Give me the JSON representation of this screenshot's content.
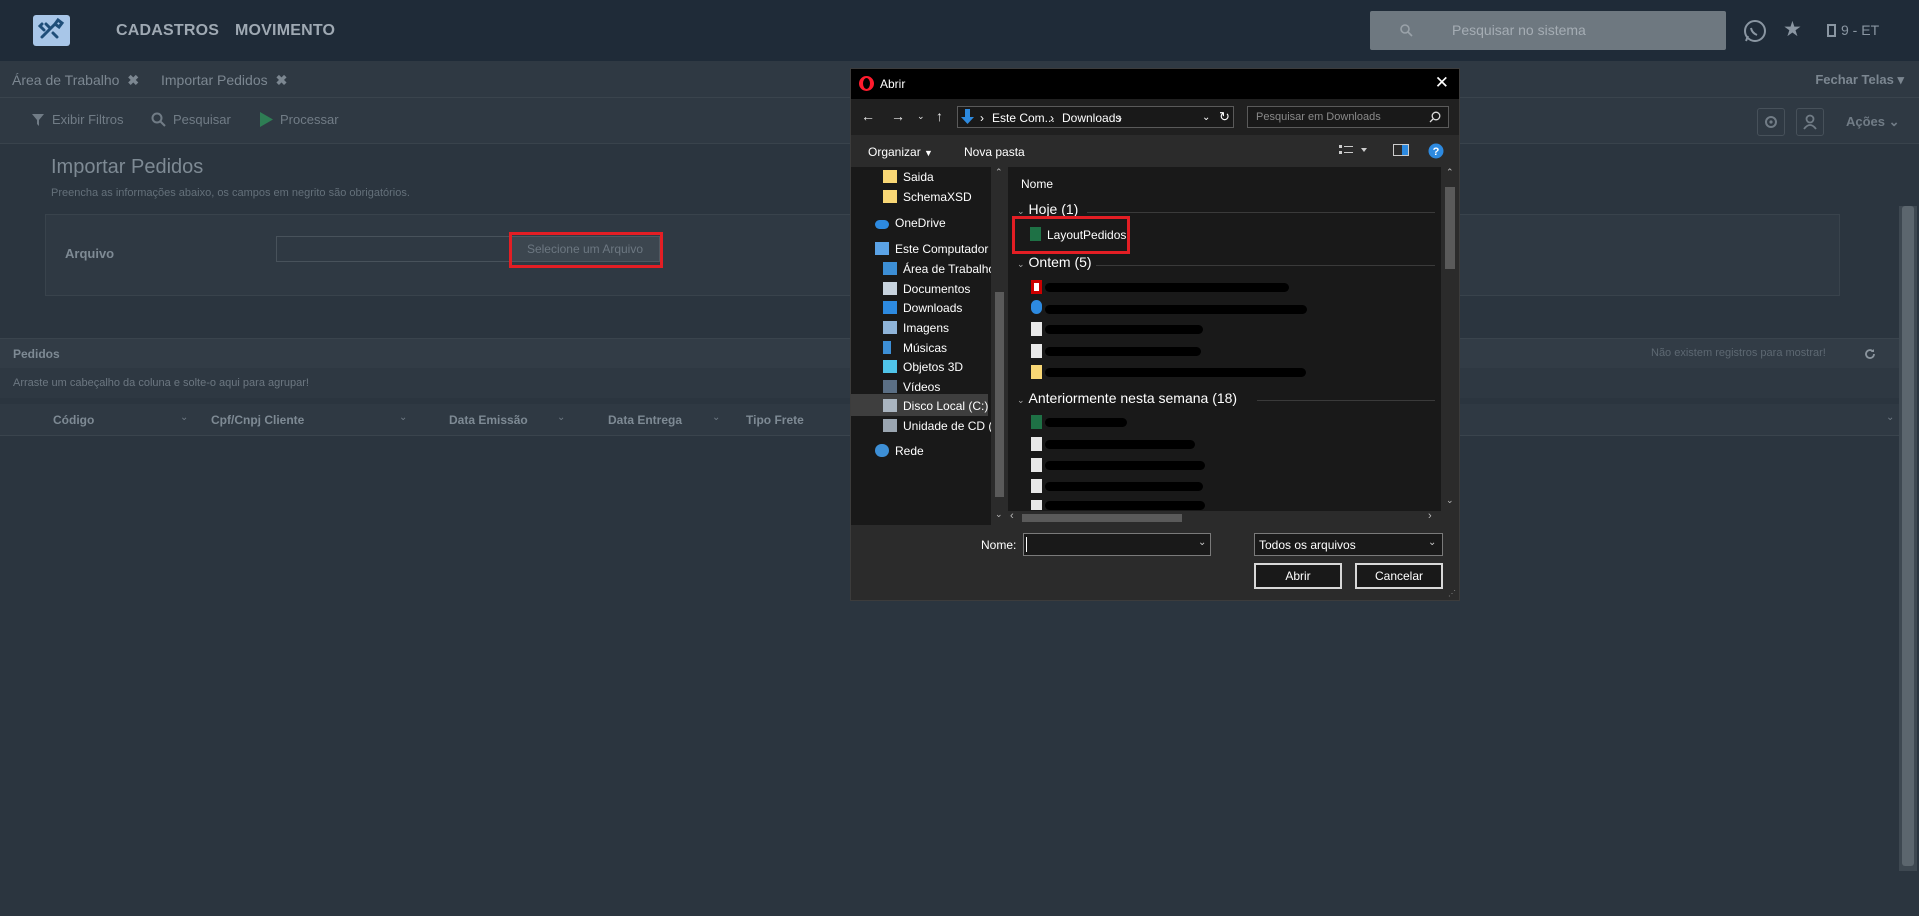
{
  "topnav": {
    "menu": [
      "CADASTROS",
      "MOVIMENTO"
    ],
    "search_placeholder": "Pesquisar no sistema",
    "company": "9 - ET"
  },
  "tabs": [
    {
      "label": "Área de Trabalho"
    },
    {
      "label": "Importar Pedidos"
    }
  ],
  "fechar_telas": "Fechar Telas",
  "toolbar": {
    "exibir_filtros": "Exibir Filtros",
    "pesquisar": "Pesquisar",
    "processar": "Processar",
    "acoes": "Ações"
  },
  "page": {
    "title": "Importar Pedidos",
    "subtitle": "Preencha as informações abaixo, os campos em negrito são obrigatórios.",
    "arquivo_label": "Arquivo",
    "select_button": "Selecione um Arquivo"
  },
  "grid": {
    "title": "Pedidos",
    "no_records": "Não existem registros para mostrar!",
    "group_hint": "Arraste um cabeçalho da coluna e solte-o aqui para agrupar!",
    "columns": [
      "Código",
      "Cpf/Cnpj Cliente",
      "Data Emissão",
      "Data Entrega",
      "Tipo Frete"
    ]
  },
  "dialog": {
    "title": "Abrir",
    "breadcrumb": [
      "Este Com...",
      "Downloads"
    ],
    "search_placeholder": "Pesquisar em Downloads",
    "organizar": "Organizar",
    "nova_pasta": "Nova pasta",
    "nav_items": [
      "Saida",
      "SchemaXSD",
      "OneDrive",
      "Este Computador",
      "Área de Trabalho",
      "Documentos",
      "Downloads",
      "Imagens",
      "Músicas",
      "Objetos 3D",
      "Vídeos",
      "Disco Local (C:)",
      "Unidade de CD (",
      "Rede"
    ],
    "column_header": "Nome",
    "groups": {
      "hoje": "Hoje (1)",
      "ontem": "Ontem (5)",
      "semana": "Anteriormente nesta semana (18)"
    },
    "highlighted_file": "LayoutPedidos",
    "nome_label": "Nome:",
    "nome_value": "",
    "file_type": "Todos os arquivos",
    "open_button": "Abrir",
    "cancel_button": "Cancelar"
  },
  "colors": {
    "highlight_red": "#e31e24",
    "excel_green": "#1e7145",
    "folder_yellow": "#f8d775",
    "accent_blue": "#2d8ae0"
  }
}
